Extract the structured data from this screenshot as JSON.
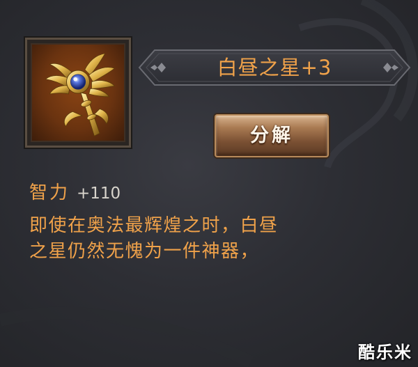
{
  "item": {
    "name": "白昼之星+3",
    "icon": "golden-winged-scepter-icon",
    "rarity_color": "#f0a24a"
  },
  "actions": {
    "decompose_label": "分解"
  },
  "stats": [
    {
      "name": "智力",
      "value": "+110"
    }
  ],
  "description": {
    "line1": "即使在奥法最辉煌之时，白昼",
    "line2": "之星仍然无愧为一件神器，"
  },
  "watermark": {
    "text": "酷乐米"
  },
  "colors": {
    "accent_text": "#f0a24a",
    "panel_bg": "#2d2e34",
    "icon_bg": "#6a3310",
    "button_bg": "#a97a52"
  }
}
